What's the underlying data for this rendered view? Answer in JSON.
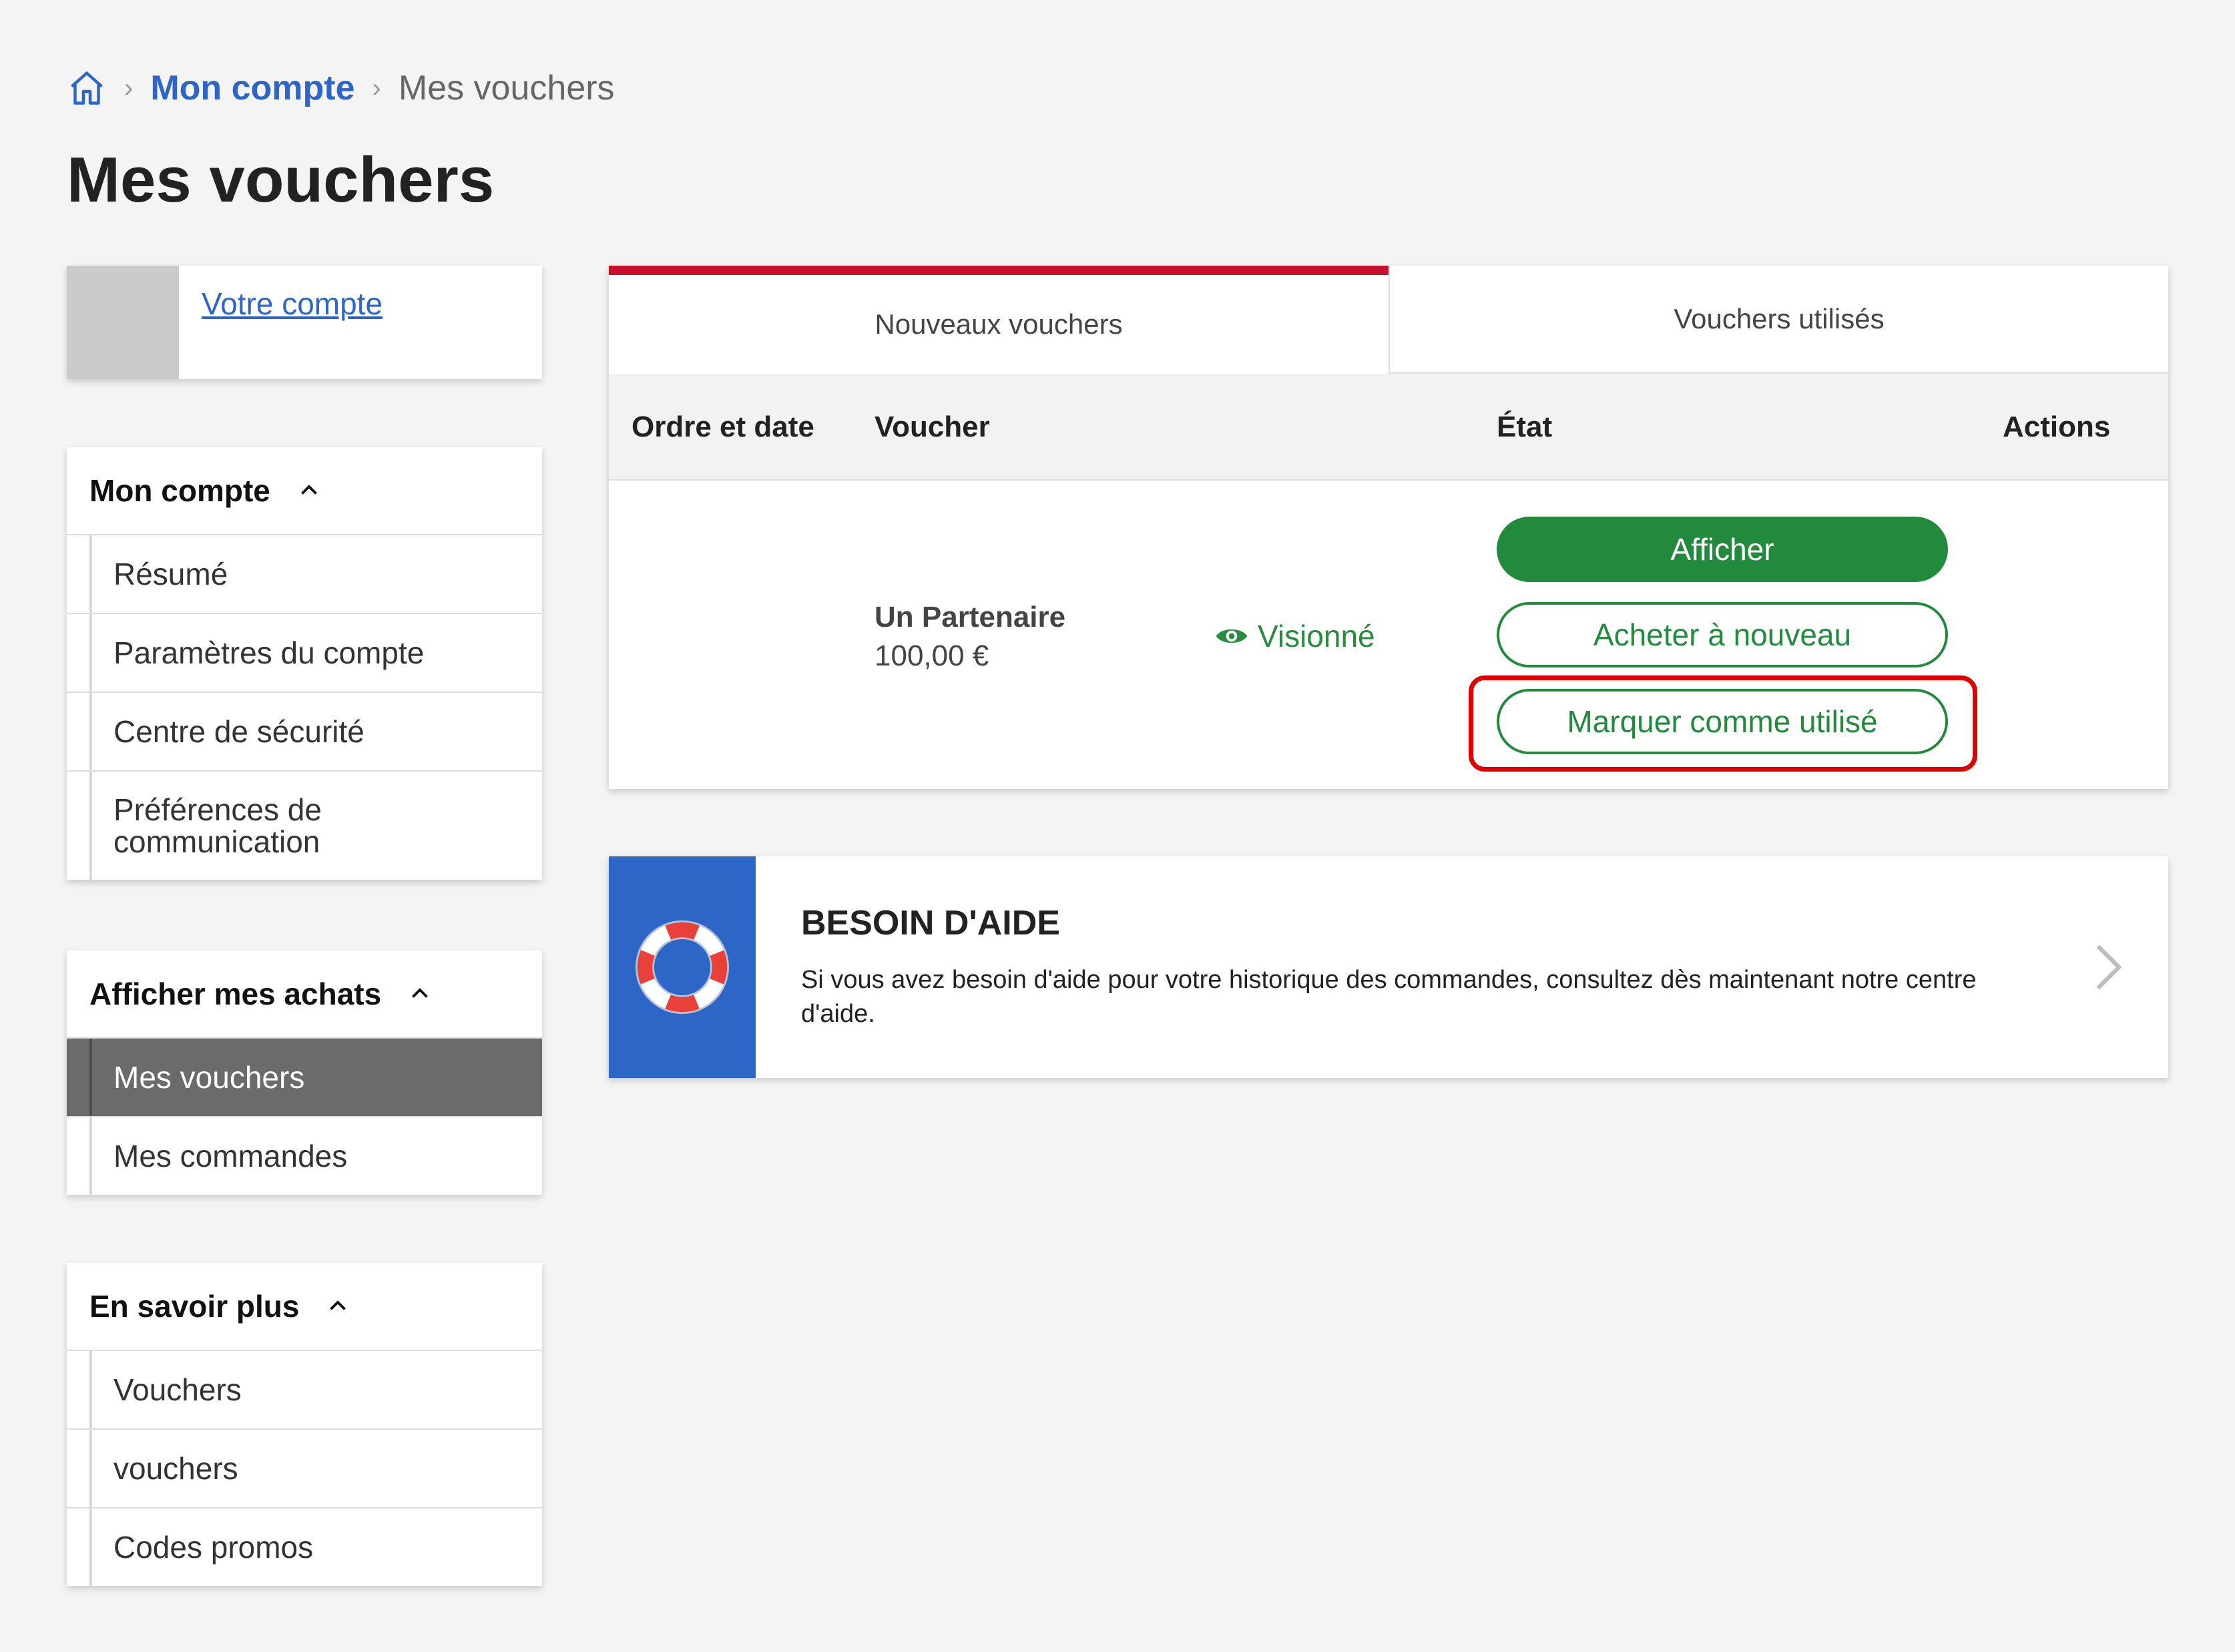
{
  "breadcrumb": {
    "home_icon": "home-icon",
    "account_label": "Mon compte",
    "current_label": "Mes vouchers"
  },
  "page_title": "Mes vouchers",
  "sidebar": {
    "account_link": "Votre compte",
    "sections": [
      {
        "title": "Mon compte",
        "items": [
          "Résumé",
          "Paramètres du compte",
          "Centre de sécurité",
          "Préférences de communication"
        ]
      },
      {
        "title": "Afficher mes achats",
        "items": [
          "Mes vouchers",
          "Mes commandes"
        ],
        "active": "Mes vouchers"
      },
      {
        "title": "En savoir plus",
        "items": [
          "Vouchers",
          "vouchers",
          "Codes promos"
        ]
      }
    ]
  },
  "tabs": {
    "new": "Nouveaux vouchers",
    "used": "Vouchers utilisés"
  },
  "table": {
    "headers": [
      "Ordre et date",
      "Voucher",
      "État",
      "Actions"
    ],
    "rows": [
      {
        "partner": "Un Partenaire",
        "amount": "100,00 €",
        "status": "Visionné",
        "actions": [
          "Afficher",
          "Acheter à nouveau",
          "Marquer comme utilisé"
        ]
      }
    ]
  },
  "help": {
    "title": "BESOIN D'AIDE",
    "text": "Si vous avez besoin d'aide pour votre historique des commandes, consultez dès maintenant notre centre d'aide."
  },
  "colors": {
    "accent_blue": "#2e66c7",
    "action_green": "#218a3c",
    "tab_red": "#c8102e",
    "highlight_red": "#e00000",
    "active_grey": "#6b6b6b"
  }
}
